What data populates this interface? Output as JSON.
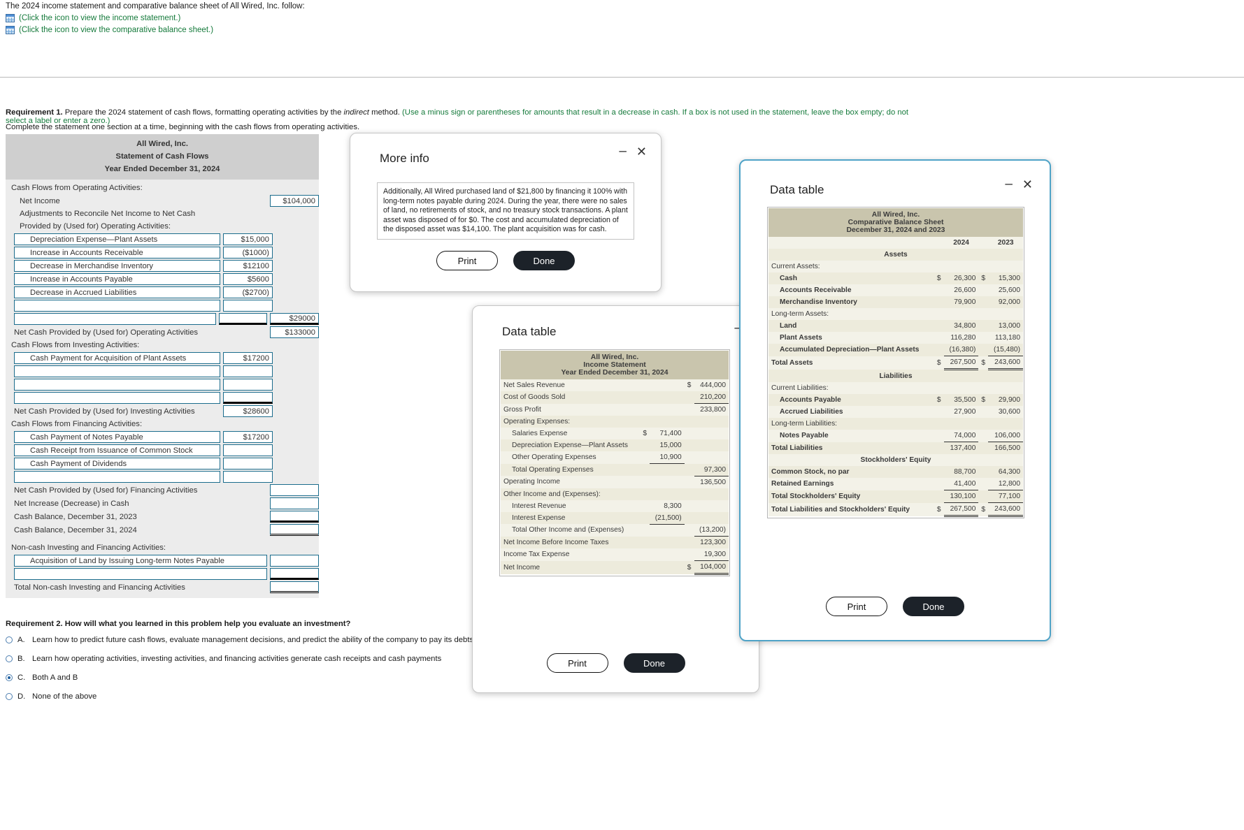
{
  "intro": {
    "line1": "The 2024 income statement and comparative balance sheet of All Wired, Inc. follow:",
    "link1": "(Click the icon to view the income statement.)",
    "link2": "(Click the icon to view the comparative balance sheet.)"
  },
  "requirement1": {
    "label": "Requirement 1.",
    "text_a": " Prepare the 2024 statement of cash flows, formatting operating activities by the ",
    "text_italic": "indirect",
    "text_b": " method. ",
    "hint": "(Use a minus sign or parentheses for amounts that result in a decrease in cash. If a box is not used in the statement, leave the box empty; do not select a label or enter a zero.)",
    "subtext": "Complete the statement one section at a time, beginning with the cash flows from operating activities."
  },
  "statement": {
    "title1": "All Wired, Inc.",
    "title2": "Statement of Cash Flows",
    "title3": "Year Ended December 31, 2024",
    "operating_header": "Cash Flows from Operating Activities:",
    "net_income_label": "Net Income",
    "net_income_value": "$104,000",
    "adjust_line1": "Adjustments to Reconcile Net Income to Net Cash",
    "adjust_line2": "Provided by (Used for) Operating Activities:",
    "operating_rows": [
      {
        "label": "Depreciation Expense—Plant Assets",
        "value": "$15,000"
      },
      {
        "label": "Increase in Accounts Receivable",
        "value": "($1000)"
      },
      {
        "label": "Decrease in Merchandise Inventory",
        "value": "$12100"
      },
      {
        "label": "Increase in Accounts Payable",
        "value": "$5600"
      },
      {
        "label": "Decrease in Accrued Liabilities",
        "value": "($2700)"
      },
      {
        "label": "",
        "value": ""
      },
      {
        "label": "",
        "value": ""
      }
    ],
    "operating_subtotal": "$29000",
    "net_operating_label": "Net Cash Provided by (Used for) Operating Activities",
    "net_operating_value": "$133000",
    "investing_header": "Cash Flows from Investing Activities:",
    "investing_rows": [
      {
        "label": "Cash Payment for Acquisition of Plant Assets",
        "value": "$17200"
      },
      {
        "label": "",
        "value": ""
      },
      {
        "label": "",
        "value": ""
      },
      {
        "label": "",
        "value": ""
      }
    ],
    "net_investing_label": "Net Cash Provided by (Used for) Investing Activities",
    "net_investing_value": "$28600",
    "financing_header": "Cash Flows from Financing Activities:",
    "financing_rows": [
      {
        "label": "Cash Payment of Notes Payable",
        "value": "$17200"
      },
      {
        "label": "Cash Receipt from Issuance of Common Stock",
        "value": ""
      },
      {
        "label": "Cash Payment of Dividends",
        "value": ""
      },
      {
        "label": "",
        "value": ""
      }
    ],
    "net_financing_label": "Net Cash Provided by (Used for) Financing Activities",
    "net_financing_value": "",
    "net_increase_label": "Net Increase (Decrease) in Cash",
    "net_increase_value": "",
    "cash_begin_label": "Cash Balance, December 31, 2023",
    "cash_begin_value": "",
    "cash_end_label": "Cash Balance, December 31, 2024",
    "cash_end_value": "",
    "noncash_header": "Non-cash Investing and Financing Activities:",
    "noncash_rows": [
      {
        "label": "Acquisition of Land by Issuing Long-term Notes Payable",
        "value": ""
      },
      {
        "label": "",
        "value": ""
      }
    ],
    "noncash_total_label": "Total Non-cash Investing and Financing Activities",
    "noncash_total_value": ""
  },
  "requirement2": {
    "label": "Requirement 2. How will what you learned in this problem help you evaluate an investment?",
    "options": [
      {
        "key": "A.",
        "text": "Learn how to predict future cash flows, evaluate management decisions, and predict the ability of the company to pay its debts and dividends",
        "selected": false
      },
      {
        "key": "B.",
        "text": "Learn how operating activities, investing activities, and financing activities generate cash receipts and cash payments",
        "selected": false
      },
      {
        "key": "C.",
        "text": "Both A and B",
        "selected": true
      },
      {
        "key": "D.",
        "text": "None of the above",
        "selected": false
      }
    ]
  },
  "more_info_dialog": {
    "title": "More info",
    "body": "Additionally, All Wired purchased land of $21,800 by financing it 100% with long-term notes payable during 2024. During the year, there were no sales of land, no retirements of stock, and no treasury stock transactions. A plant asset was disposed of for $0. The cost and accumulated depreciation of the disposed asset was $14,100. The plant acquisition was for cash.",
    "print_label": "Print",
    "done_label": "Done",
    "minimize_glyph": "–",
    "close_glyph": "✕"
  },
  "income_statement_dialog": {
    "title": "Data table",
    "print_label": "Print",
    "done_label": "Done",
    "minimize_glyph": "–",
    "table": {
      "title1": "All Wired, Inc.",
      "title2": "Income Statement",
      "title3": "Year Ended December 31, 2024",
      "rows": [
        {
          "label": "Net Sales Revenue",
          "indent": 0,
          "cur2": "$",
          "col2": "444,000"
        },
        {
          "label": "Cost of Goods Sold",
          "indent": 0,
          "col2": "210,200",
          "ul2": true
        },
        {
          "label": "Gross Profit",
          "indent": 0,
          "col2": "233,800"
        },
        {
          "label": "Operating Expenses:",
          "indent": 0
        },
        {
          "label": "Salaries Expense",
          "indent": 1,
          "cur1": "$",
          "col1": "71,400"
        },
        {
          "label": "Depreciation Expense—Plant Assets",
          "indent": 1,
          "col1": "15,000"
        },
        {
          "label": "Other Operating Expenses",
          "indent": 1,
          "col1": "10,900",
          "ul1": true
        },
        {
          "label": "Total Operating Expenses",
          "indent": 1,
          "col2": "97,300",
          "ul2": true
        },
        {
          "label": "Operating Income",
          "indent": 0,
          "col2": "136,500"
        },
        {
          "label": "Other Income and (Expenses):",
          "indent": 0
        },
        {
          "label": "Interest Revenue",
          "indent": 1,
          "col1": "8,300"
        },
        {
          "label": "Interest Expense",
          "indent": 1,
          "col1": "(21,500)",
          "ul1": true
        },
        {
          "label": "Total Other Income and (Expenses)",
          "indent": 1,
          "col2": "(13,200)",
          "ul2": true
        },
        {
          "label": "Net Income Before Income Taxes",
          "indent": 0,
          "col2": "123,300"
        },
        {
          "label": "Income Tax Expense",
          "indent": 0,
          "col2": "19,300",
          "ul2": true
        },
        {
          "label": "Net Income",
          "indent": 0,
          "cur2": "$",
          "col2": "104,000",
          "dul2": true
        }
      ]
    }
  },
  "balance_sheet_dialog": {
    "title": "Data table",
    "print_label": "Print",
    "done_label": "Done",
    "minimize_glyph": "–",
    "close_glyph": "✕",
    "table": {
      "title1": "All Wired, Inc.",
      "title2": "Comparative Balance Sheet",
      "title3": "December 31, 2024 and 2023",
      "year_cols": [
        "2024",
        "2023"
      ],
      "rows": [
        {
          "label": "Assets",
          "section": true
        },
        {
          "label": "Current Assets:",
          "indent": 0
        },
        {
          "label": "Cash",
          "indent": 1,
          "bold": true,
          "cur1": "$",
          "col1": "26,300",
          "cur2": "$",
          "col2": "15,300"
        },
        {
          "label": "Accounts Receivable",
          "indent": 1,
          "bold": true,
          "col1": "26,600",
          "col2": "25,600"
        },
        {
          "label": "Merchandise Inventory",
          "indent": 1,
          "bold": true,
          "col1": "79,900",
          "col2": "92,000"
        },
        {
          "label": "Long-term Assets:",
          "indent": 0
        },
        {
          "label": "Land",
          "indent": 1,
          "bold": true,
          "col1": "34,800",
          "col2": "13,000"
        },
        {
          "label": "Plant Assets",
          "indent": 1,
          "bold": true,
          "col1": "116,280",
          "col2": "113,180"
        },
        {
          "label": "Accumulated Depreciation—Plant Assets",
          "indent": 1,
          "bold": true,
          "col1": "(16,380)",
          "col2": "(15,480)",
          "ul": true
        },
        {
          "label": "Total Assets",
          "indent": 0,
          "bold": true,
          "cur1": "$",
          "col1": "267,500",
          "cur2": "$",
          "col2": "243,600",
          "dul": true
        },
        {
          "label": "Liabilities",
          "section": true
        },
        {
          "label": "Current Liabilities:",
          "indent": 0
        },
        {
          "label": "Accounts Payable",
          "indent": 1,
          "bold": true,
          "cur1": "$",
          "col1": "35,500",
          "cur2": "$",
          "col2": "29,900"
        },
        {
          "label": "Accrued Liabilities",
          "indent": 1,
          "bold": true,
          "col1": "27,900",
          "col2": "30,600"
        },
        {
          "label": "Long-term Liabilities:",
          "indent": 0
        },
        {
          "label": "Notes Payable",
          "indent": 1,
          "bold": true,
          "col1": "74,000",
          "col2": "106,000",
          "ul": true
        },
        {
          "label": "Total Liabilities",
          "indent": 0,
          "bold": true,
          "col1": "137,400",
          "col2": "166,500"
        },
        {
          "label": "Stockholders' Equity",
          "section": true
        },
        {
          "label": "Common Stock, no par",
          "indent": 0,
          "bold": true,
          "col1": "88,700",
          "col2": "64,300"
        },
        {
          "label": "Retained Earnings",
          "indent": 0,
          "bold": true,
          "col1": "41,400",
          "col2": "12,800",
          "ul": true
        },
        {
          "label": "Total Stockholders' Equity",
          "indent": 0,
          "bold": true,
          "col1": "130,100",
          "col2": "77,100",
          "ul": true
        },
        {
          "label": "Total Liabilities and Stockholders' Equity",
          "indent": 0,
          "bold": true,
          "cur1": "$",
          "col1": "267,500",
          "cur2": "$",
          "col2": "243,600",
          "dul": true
        }
      ]
    }
  }
}
